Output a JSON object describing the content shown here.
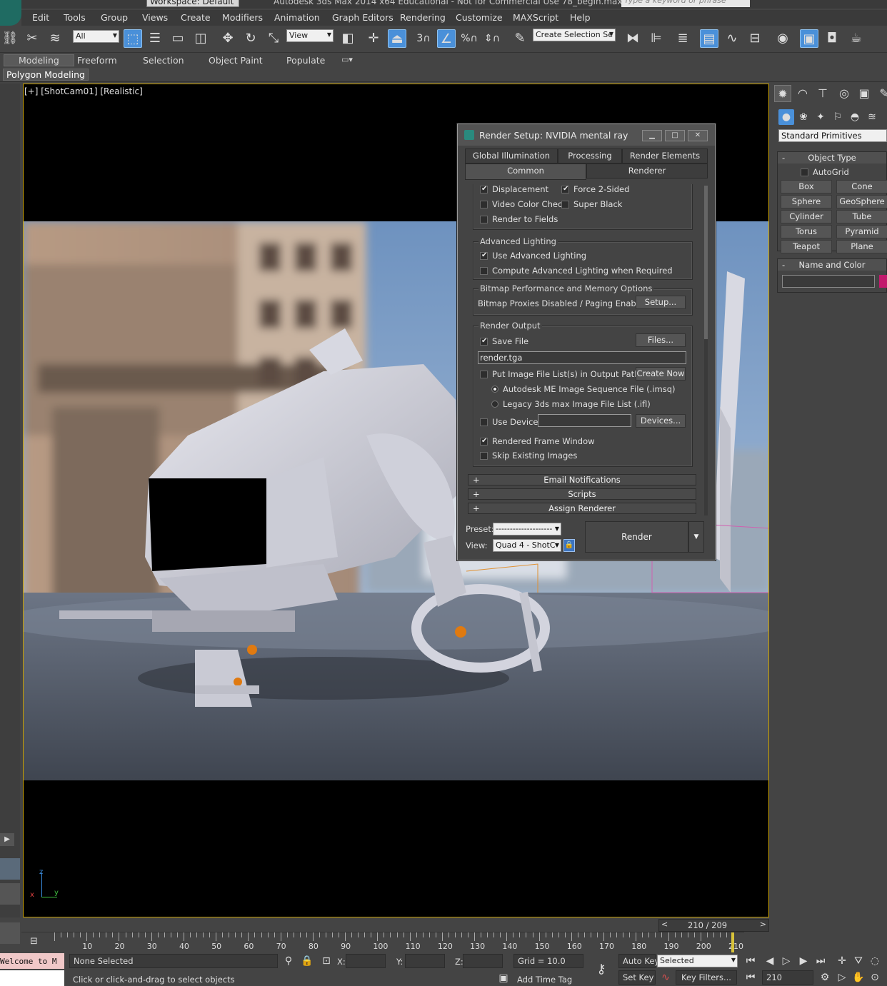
{
  "app": {
    "workspace_label": "Workspace: Default",
    "title": "Autodesk 3ds Max  2014 x64    Educational - Not for Commercial Use    78_begin.max",
    "search_placeholder": "Type a keyword or phrase"
  },
  "menu": [
    "Edit",
    "Tools",
    "Group",
    "Views",
    "Create",
    "Modifiers",
    "Animation",
    "Graph Editors",
    "Rendering",
    "Customize",
    "MAXScript",
    "Help"
  ],
  "toolbar": {
    "filter_value": "All",
    "ref_coord_value": "View",
    "snap_label": "3",
    "selection_set_value": "Create Selection Se"
  },
  "ribbon": {
    "tabs": [
      "Modeling",
      "Freeform",
      "Selection",
      "Object Paint",
      "Populate"
    ],
    "active_tab": "Modeling",
    "panel_label": "Polygon Modeling"
  },
  "viewport": {
    "label": "[+] [ShotCam01] [Realistic]",
    "axis_z": "z",
    "axis_x": "x",
    "axis_y": "y"
  },
  "command_panel": {
    "category_value": "Standard Primitives",
    "object_type_title": "Object Type",
    "autogrid_label": "AutoGrid",
    "primitives": [
      "Box",
      "Cone",
      "Sphere",
      "GeoSphere",
      "Cylinder",
      "Tube",
      "Torus",
      "Pyramid",
      "Teapot",
      "Plane"
    ],
    "name_color_title": "Name and Color",
    "object_color": "#c2186c"
  },
  "dialog": {
    "title": "Render Setup: NVIDIA mental ray",
    "tabs_row1": [
      "Global Illumination",
      "Processing",
      "Render Elements"
    ],
    "tabs_row2": [
      "Common",
      "Renderer"
    ],
    "active_tab": "Common",
    "options": {
      "displacement": "Displacement",
      "force_2sided": "Force 2-Sided",
      "video_color_check": "Video Color Check",
      "super_black": "Super Black",
      "render_to_fields": "Render to Fields"
    },
    "advanced_lighting": {
      "title": "Advanced Lighting",
      "use": "Use Advanced Lighting",
      "compute": "Compute Advanced Lighting when Required"
    },
    "bitmap": {
      "title": "Bitmap Performance and Memory Options",
      "status": "Bitmap Proxies Disabled / Paging Enabled",
      "setup_button": "Setup..."
    },
    "render_output": {
      "title": "Render Output",
      "save_file": "Save File",
      "files_button": "Files...",
      "file_path": "render.tga",
      "put_image_list": "Put Image File List(s) in Output Path(s)",
      "create_now_button": "Create Now",
      "imsq_option": "Autodesk ME Image Sequence File (.imsq)",
      "ifl_option": "Legacy 3ds max Image File List (.ifl)",
      "use_device": "Use Device",
      "devices_button": "Devices...",
      "rendered_frame_window": "Rendered Frame Window",
      "skip_existing": "Skip Existing Images"
    },
    "rollouts": [
      "Email Notifications",
      "Scripts",
      "Assign Renderer"
    ],
    "footer": {
      "preset_label": "Preset:",
      "preset_value": "--------------------",
      "view_label": "View:",
      "view_value": "Quad 4 - ShotC",
      "render_button": "Render"
    }
  },
  "timeline": {
    "slider_value": "210 / 209",
    "prev": "<",
    "next": ">",
    "ticks": [
      "10",
      "20",
      "30",
      "40",
      "50",
      "60",
      "70",
      "80",
      "90",
      "100",
      "110",
      "120",
      "130",
      "140",
      "150",
      "160",
      "170",
      "180",
      "190",
      "200",
      "210"
    ],
    "current_frame": 210,
    "total_frames": 210
  },
  "status_bar": {
    "listener_text": "Welcome to M",
    "selection_status": "None Selected",
    "prompt": "Click or click-and-drag to select objects",
    "x_label": "X:",
    "y_label": "Y:",
    "z_label": "Z:",
    "grid": "Grid = 10.0",
    "add_time_tag": "Add Time Tag",
    "auto_key": "Auto Key",
    "set_key": "Set Key",
    "key_mode_value": "Selected",
    "key_filters": "Key Filters...",
    "frame_value": "210"
  }
}
